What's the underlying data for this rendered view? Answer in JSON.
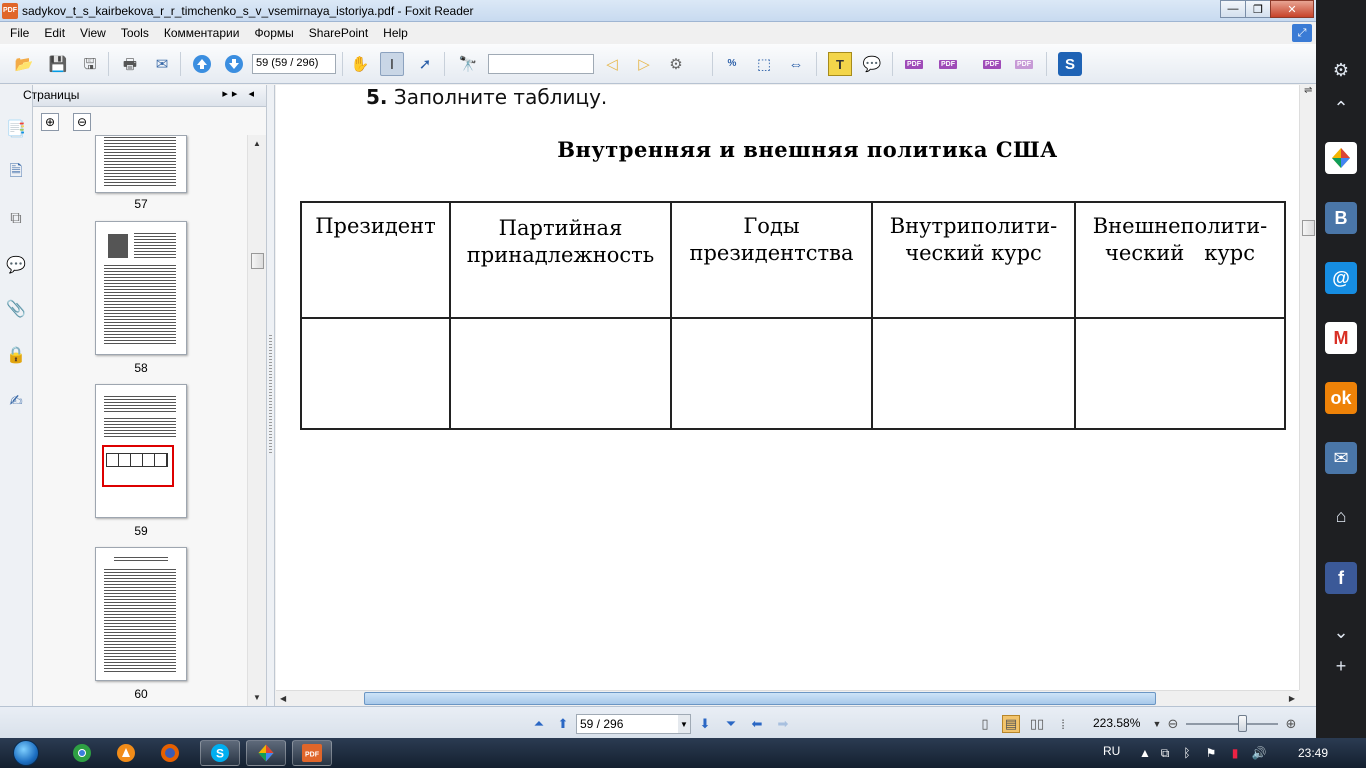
{
  "window": {
    "title": "sadykov_t_s_kairbekova_r_r_timchenko_s_v_vsemirnaya_istoriya.pdf - Foxit Reader",
    "app_icon_text": "PDF"
  },
  "menu": [
    "File",
    "Edit",
    "View",
    "Tools",
    "Комментарии",
    "Формы",
    "SharePoint",
    "Help"
  ],
  "toolbar": {
    "page_field": "59 (59 / 296)",
    "search_value": ""
  },
  "pages_panel": {
    "title": "Страницы",
    "thumbnails": [
      {
        "label": "57"
      },
      {
        "label": "58"
      },
      {
        "label": "59"
      },
      {
        "label": "60"
      }
    ]
  },
  "document": {
    "task_number": "5.",
    "task_text": "Заполните таблицу.",
    "table_title": "Внутренняя и внешняя политика США",
    "columns": [
      [
        "Президент"
      ],
      [
        "Партийная",
        "принадлежность"
      ],
      [
        "Годы",
        "президентства"
      ],
      [
        "Внутриполити-",
        "ческий курс"
      ],
      [
        "Внешнеполити-",
        "ческий   курс"
      ]
    ]
  },
  "statusbar": {
    "page_field": "59 / 296",
    "zoom": "223.58%"
  },
  "taskbar": {
    "language": "RU",
    "time": "23:49"
  },
  "colors": {
    "taskbar": "#14202f",
    "side_panel": "#1e1f22",
    "selected_thumb_outline": "#dd0000"
  }
}
